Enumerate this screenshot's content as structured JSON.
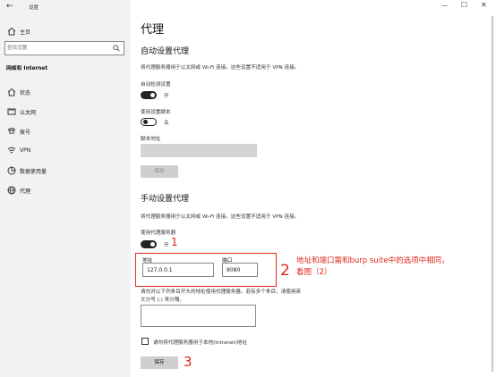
{
  "window": {
    "title": "设置",
    "controls": {
      "minimize": "—",
      "maximize": "☐",
      "close": "✕"
    }
  },
  "sidebar": {
    "home_label": "主页",
    "search_placeholder": "查找设置",
    "category": "网络和 Internet",
    "items": [
      {
        "label": "状态",
        "icon": "home-status-icon"
      },
      {
        "label": "以太网",
        "icon": "ethernet-icon"
      },
      {
        "label": "拨号",
        "icon": "dialup-icon"
      },
      {
        "label": "VPN",
        "icon": "vpn-icon"
      },
      {
        "label": "数据使用量",
        "icon": "data-usage-icon"
      },
      {
        "label": "代理",
        "icon": "globe-icon",
        "active": true
      }
    ]
  },
  "main": {
    "page_title": "代理",
    "auto": {
      "heading": "自动设置代理",
      "desc": "将代理服务器用于以太网或 Wi-Fi 连接。这些设置不适用于 VPN 连接。",
      "detect_label": "自动检测设置",
      "detect_state": "开",
      "script_label": "使用设置脚本",
      "script_state": "关",
      "script_addr_label": "脚本地址",
      "script_addr_value": "",
      "save_label": "保存"
    },
    "manual": {
      "heading": "手动设置代理",
      "desc": "将代理服务器用于以太网或 Wi-Fi 连接。这些设置不适用于 VPN 连接。",
      "use_proxy_label": "使用代理服务器",
      "use_proxy_state": "开",
      "address_label": "地址",
      "address_value": "127.0.0.1",
      "port_label": "端口",
      "port_value": "8080",
      "exceptions_desc_line1": "请勿对以下列条目开头的地址使用代理服务器。若有多个条目，请使用英",
      "exceptions_desc_line2": "文分号 (;) 来分隔。",
      "exceptions_value": "",
      "bypass_local_label": "请勿将代理服务器用于本地(Intranet)地址",
      "bypass_local_checked": false,
      "save_label": "保存"
    }
  },
  "annotations": {
    "mark1": "1",
    "mark2": "2",
    "mark3": "3",
    "note_line1": "地址和端口需和burp suite中的选项中相同，",
    "note_line2": "看图（2）",
    "color": "#e0281e"
  }
}
